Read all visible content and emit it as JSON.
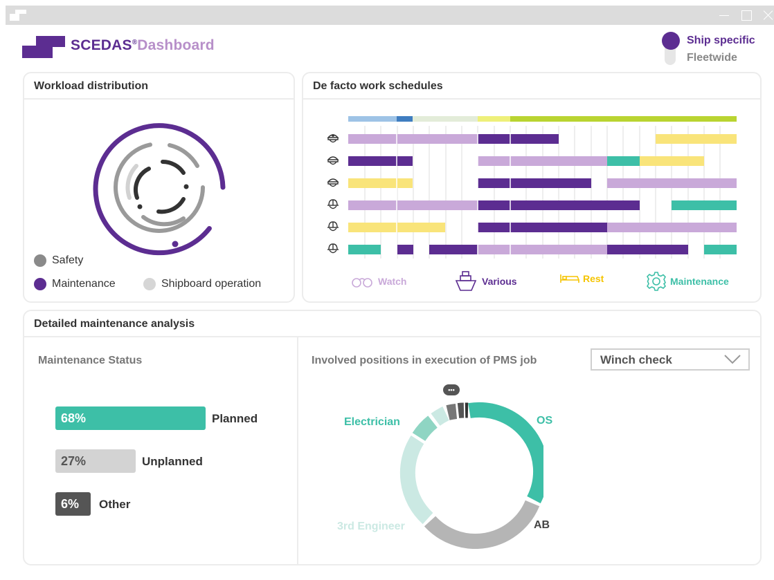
{
  "header": {
    "brand_primary": "SCEDAS",
    "brand_mark": "®",
    "brand_secondary": "Dashboard",
    "scope_selected": "Ship specific",
    "scope_other": "Fleetwide"
  },
  "workload": {
    "title": "Workload distribution",
    "legend": [
      {
        "label": "Safety",
        "color": "#8a8a8a"
      },
      {
        "label": "Maintenance",
        "color": "#5c2d91"
      },
      {
        "label": "Shipboard operation",
        "color": "#d6d6d6"
      }
    ]
  },
  "schedules": {
    "title": "De facto work schedules",
    "crew_icons": [
      "captain-cap-icon",
      "officer-cap-icon",
      "officer-cap-icon",
      "hard-hat-icon",
      "hard-hat-icon",
      "hard-hat-icon"
    ],
    "legend": [
      {
        "label": "Watch",
        "icon": "binoculars-icon",
        "color": "#c9a9d9"
      },
      {
        "label": "Various",
        "icon": "ship-icon",
        "color": "#5c2d91"
      },
      {
        "label": "Rest",
        "icon": "bed-icon",
        "color": "#f5d94a"
      },
      {
        "label": "Maintenance",
        "icon": "gear-icon",
        "color": "#3dbfa7"
      }
    ]
  },
  "analysis": {
    "title": "Detailed maintenance analysis",
    "status_title": "Maintenance Status",
    "status": [
      {
        "pct": "68%",
        "label": "Planned",
        "value": 0.68,
        "color": "#3dbfa7"
      },
      {
        "pct": "27%",
        "label": "Unplanned",
        "value": 0.27,
        "color": "#d3d3d3"
      },
      {
        "pct": "6%",
        "label": "Other",
        "value": 0.06,
        "color": "#555555"
      }
    ],
    "positions_title": "Involved positions in execution of PMS job",
    "job_selected": "Winch check",
    "positions": [
      {
        "label": "OS",
        "color": "#3dbfa7"
      },
      {
        "label": "AB",
        "color": "#b5b5b5"
      },
      {
        "label": "3rd Engineer",
        "color": "#cbe9e3"
      },
      {
        "label": "Electrician",
        "color": "#8fd5c3"
      }
    ],
    "more_label": "•••"
  }
}
